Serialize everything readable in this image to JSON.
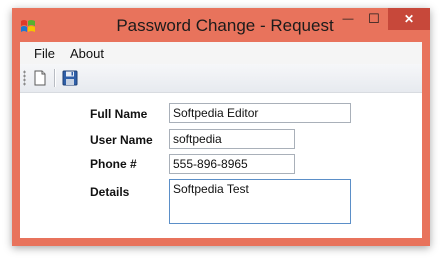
{
  "window": {
    "title": "Password Change - Request",
    "minimize_glyph": "—",
    "maximize_glyph": "☐",
    "close_glyph": "✕"
  },
  "menu": {
    "items": [
      {
        "label": "File"
      },
      {
        "label": "About"
      }
    ]
  },
  "toolbar": {
    "buttons": [
      {
        "icon": "new-document-icon"
      },
      {
        "icon": "save-icon"
      }
    ]
  },
  "form": {
    "full_name": {
      "label": "Full Name",
      "value": "Softpedia Editor"
    },
    "user_name": {
      "label": "User Name",
      "value": "softpedia"
    },
    "phone": {
      "label": "Phone #",
      "value": "555-896-8965"
    },
    "details": {
      "label": "Details",
      "value": "Softpedia Test"
    }
  },
  "colors": {
    "window_frame": "#e8735c",
    "close_button": "#c7483a",
    "focus_border": "#5b8fc8"
  }
}
